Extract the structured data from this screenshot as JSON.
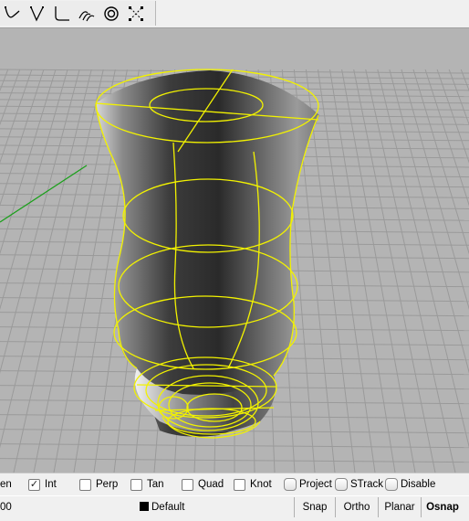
{
  "toolbar": {
    "buttons": [
      {
        "name": "curve-sketch-icon"
      },
      {
        "name": "polyline-icon"
      },
      {
        "name": "fillet-curve-icon"
      },
      {
        "name": "offset-curve-icon"
      },
      {
        "name": "circle-tangent-icon"
      },
      {
        "name": "control-points-icon"
      }
    ]
  },
  "viewport": {
    "grid_color": "#9a9a9a",
    "axis_color": "#1aa01a",
    "wire_color": "#f2f200"
  },
  "osnap": {
    "items": [
      {
        "label": "en",
        "checked": false,
        "style": "cut"
      },
      {
        "label": "Int",
        "checked": true,
        "style": "check"
      },
      {
        "label": "Perp",
        "checked": false,
        "style": "check"
      },
      {
        "label": "Tan",
        "checked": false,
        "style": "check"
      },
      {
        "label": "Quad",
        "checked": false,
        "style": "check"
      },
      {
        "label": "Knot",
        "checked": false,
        "style": "check"
      },
      {
        "label": "Project",
        "checked": false,
        "style": "toggle"
      },
      {
        "label": "STrack",
        "checked": false,
        "style": "toggle"
      },
      {
        "label": "Disable",
        "checked": false,
        "style": "toggle"
      }
    ]
  },
  "status": {
    "coord_text": "00",
    "layer": "Default",
    "panes": [
      {
        "label": "Snap",
        "bold": false
      },
      {
        "label": "Ortho",
        "bold": false
      },
      {
        "label": "Planar",
        "bold": false
      },
      {
        "label": "Osnap",
        "bold": true
      }
    ]
  }
}
